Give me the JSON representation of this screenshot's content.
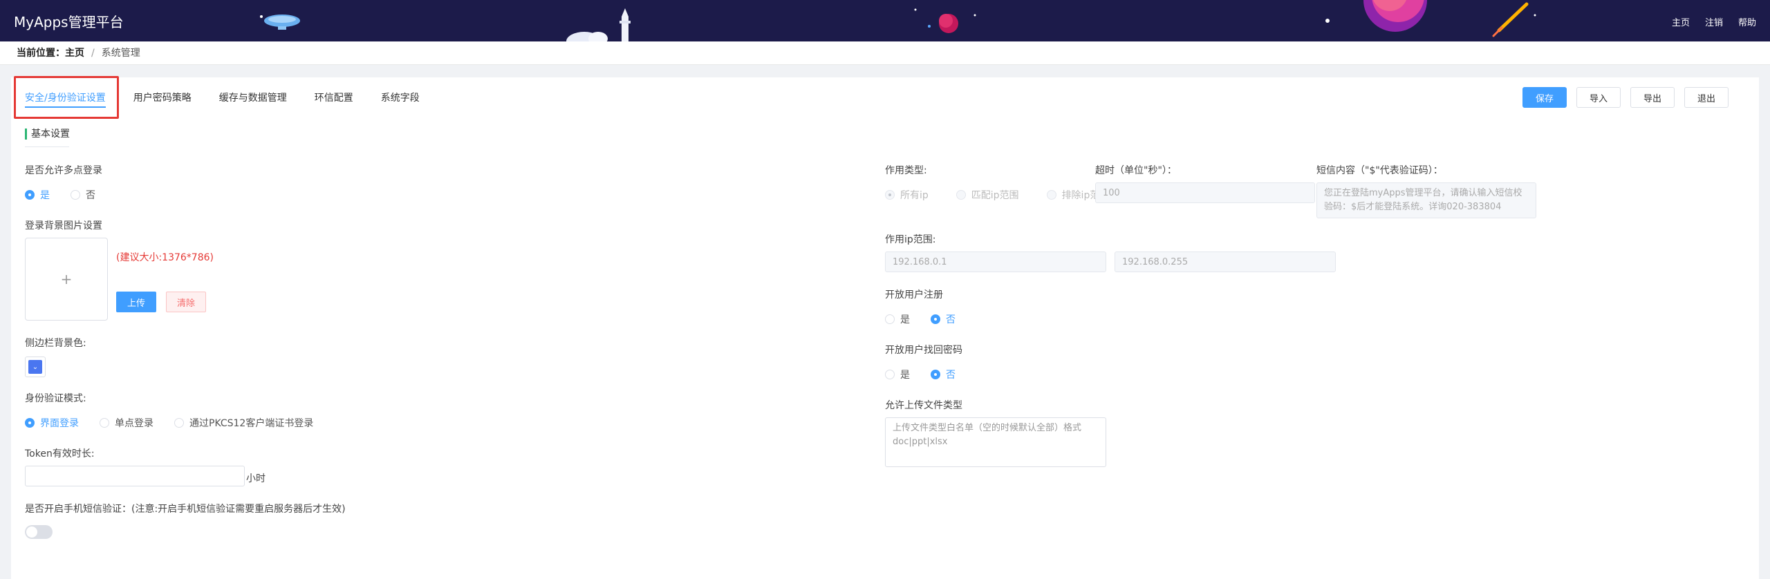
{
  "header": {
    "brand": "MyApps管理平台",
    "nav": {
      "home": "主页",
      "logout": "注销",
      "help": "帮助"
    }
  },
  "breadcrumb": {
    "label": "当前位置：",
    "home": "主页",
    "separator": "/",
    "current": "系统管理"
  },
  "tabs": [
    {
      "label": "安全/身份验证设置",
      "active": true
    },
    {
      "label": "用户密码策略"
    },
    {
      "label": "缓存与数据管理"
    },
    {
      "label": "环信配置"
    },
    {
      "label": "系统字段"
    }
  ],
  "actions": {
    "save": "保存",
    "import": "导入",
    "export": "导出",
    "exit": "退出"
  },
  "section": {
    "title": "基本设置"
  },
  "left": {
    "multi_login": {
      "label": "是否允许多点登录",
      "options": [
        "是",
        "否"
      ],
      "selected": "是"
    },
    "bg_image": {
      "label": "登录背景图片设置",
      "plus": "+",
      "hint": "(建议大小:1376*786)",
      "upload": "上传",
      "clear": "清除"
    },
    "sidebar_color": {
      "label": "侧边栏背景色:",
      "value": "#4a76f0",
      "arrow": "⌄"
    },
    "auth_mode": {
      "label": "身份验证模式:",
      "options": [
        "界面登录",
        "单点登录",
        "通过PKCS12客户端证书登录"
      ],
      "selected": "界面登录"
    },
    "token": {
      "label": "Token有效时长:",
      "value": "",
      "unit": "小时"
    },
    "sms": {
      "label": "是否开启手机短信验证：(注意:开启手机短信验证需要重启服务器后才生效)",
      "enabled": false
    }
  },
  "right": {
    "scope_type": {
      "label": "作用类型:",
      "options": [
        "所有ip",
        "匹配ip范围",
        "排除ip范围"
      ],
      "selected": "所有ip"
    },
    "timeout": {
      "label": "超时（单位\"秒\"）：",
      "value": "100"
    },
    "sms_content": {
      "label": "短信内容（\"$\"代表验证码）：",
      "value": "您正在登陆myApps管理平台，请确认输入短信校验码：$后才能登陆系统。详询020-383804"
    },
    "ip_range": {
      "label": "作用ip范围:",
      "start": "192.168.0.1",
      "end": "192.168.0.255"
    },
    "register": {
      "label": "开放用户注册",
      "options": [
        "是",
        "否"
      ],
      "selected": "否"
    },
    "recover": {
      "label": "开放用户找回密码",
      "options": [
        "是",
        "否"
      ],
      "selected": "否"
    },
    "upload_types": {
      "label": "允许上传文件类型",
      "placeholder": "上传文件类型白名单（空的时候默认全部）格式doc|ppt|xlsx"
    }
  }
}
